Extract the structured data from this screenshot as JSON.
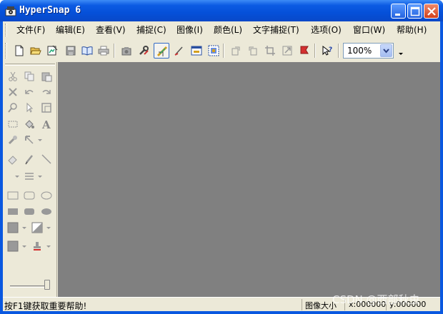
{
  "window": {
    "title": "HyperSnap 6",
    "icons": {
      "app": "hypersnap-app-icon",
      "minimize": "minimize-icon",
      "maximize": "maximize-icon",
      "close": "close-icon"
    }
  },
  "menubar": {
    "items": [
      {
        "label": "文件(F)"
      },
      {
        "label": "编辑(E)"
      },
      {
        "label": "查看(V)"
      },
      {
        "label": "捕捉(C)"
      },
      {
        "label": "图像(I)"
      },
      {
        "label": "颜色(L)"
      },
      {
        "label": "文字捕捉(T)"
      },
      {
        "label": "选项(O)"
      },
      {
        "label": "窗口(W)"
      },
      {
        "label": "帮助(H)"
      }
    ]
  },
  "toolbar": {
    "icons": [
      "new-file-icon",
      "open-folder-icon",
      "open-image-icon",
      "save-icon",
      "book-icon",
      "print-icon",
      "camera-icon",
      "tools-icon",
      "capture-active-icon",
      "pen-icon",
      "capture-region-icon",
      "capture-grid-icon",
      "rotate-right-icon",
      "rotate-left-icon",
      "crop-icon",
      "resize-icon",
      "flag-icon",
      "help-pointer-icon"
    ],
    "zoom": {
      "value": "100%"
    }
  },
  "left_panel": {
    "icons": [
      "cut-icon",
      "copy-icon",
      "paste-icon",
      "delete-icon",
      "undo-icon",
      "redo-icon",
      "zoom-icon",
      "pointer-icon",
      "frame-icon",
      "select-rect-icon",
      "fill-bucket-icon",
      "text-icon",
      "stamp-icon",
      "arrow-icon",
      "eraser-icon",
      "pencil-icon",
      "line-icon",
      "line-width-icon",
      "rectangle-icon",
      "rounded-rectangle-icon",
      "ellipse-icon",
      "filled-rectangle-icon",
      "filled-rounded-rectangle-icon",
      "filled-ellipse-icon",
      "fill-color-icon",
      "gradient-icon",
      "color-icon",
      "stamp-tool-icon"
    ]
  },
  "statusbar": {
    "message": "按F1键获取重要帮助!",
    "image_size_label": "图像大小",
    "x_value": "x:000000",
    "y_value": "y:000000"
  },
  "watermark": {
    "text": "CSDN @西部秋虫"
  }
}
